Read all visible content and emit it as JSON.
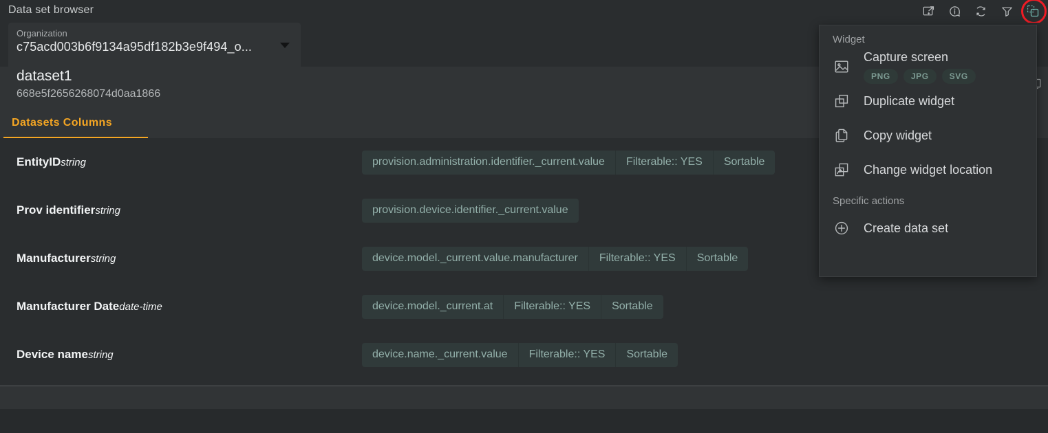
{
  "topbar": {
    "title": "Data set browser",
    "icons": [
      {
        "name": "export-open-new-icon",
        "label": "Open in new window"
      },
      {
        "name": "info-icon",
        "label": "Information"
      },
      {
        "name": "refresh-icon",
        "label": "Refresh"
      },
      {
        "name": "filter-icon",
        "label": "Filter"
      },
      {
        "name": "widget-icon",
        "label": "Widget actions"
      }
    ],
    "annotation_color": "#ee1c25"
  },
  "organization": {
    "label": "Organization",
    "value": "c75acd003b6f9134a95df182b3e9f494_o...",
    "caret": "chevron-down-icon"
  },
  "dataset": {
    "name": "dataset1",
    "id": "668e5f2656268074d0aa1866"
  },
  "tabs": [
    {
      "label": "Datasets Columns",
      "active": true
    }
  ],
  "columns": [
    {
      "name": "EntityID",
      "type": "string",
      "chips": [
        "provision.administration.identifier._current.value",
        "Filterable:: YES",
        "Sortable"
      ]
    },
    {
      "name": "Prov identifier",
      "type": "string",
      "chips": [
        "provision.device.identifier._current.value"
      ]
    },
    {
      "name": "Manufacturer",
      "type": "string",
      "chips": [
        "device.model._current.value.manufacturer",
        "Filterable:: YES",
        "Sortable"
      ]
    },
    {
      "name": "Manufacturer Date",
      "type": "date-time",
      "chips": [
        "device.model._current.at",
        "Filterable:: YES",
        "Sortable"
      ]
    },
    {
      "name": "Device name",
      "type": "string",
      "chips": [
        "device.name._current.value",
        "Filterable:: YES",
        "Sortable"
      ]
    }
  ],
  "menu": {
    "sections": [
      {
        "title": "Widget"
      },
      {
        "title": "Specific actions"
      }
    ],
    "widget_section_title": "Widget",
    "specific_section_title": "Specific actions",
    "capture": {
      "label": "Capture screen",
      "icon": "image-icon",
      "formats": [
        "PNG",
        "JPG",
        "SVG"
      ]
    },
    "items": [
      {
        "label": "Duplicate widget",
        "icon": "duplicate-icon"
      },
      {
        "label": "Copy widget",
        "icon": "copy-icon"
      },
      {
        "label": "Change widget location",
        "icon": "move-location-icon"
      }
    ],
    "specific_items": [
      {
        "label": "Create data set",
        "icon": "plus-circle-icon"
      }
    ]
  },
  "colors": {
    "accent": "#f5a623",
    "chip_bg": "#303a3a",
    "chip_text": "#93b0aa",
    "panel_bg": "#2a2d2f",
    "band_bg": "#313436",
    "menu_bg": "#2e3133",
    "annotation": "#ee1c25",
    "widget_icon_accent": "#6fb5ad"
  }
}
